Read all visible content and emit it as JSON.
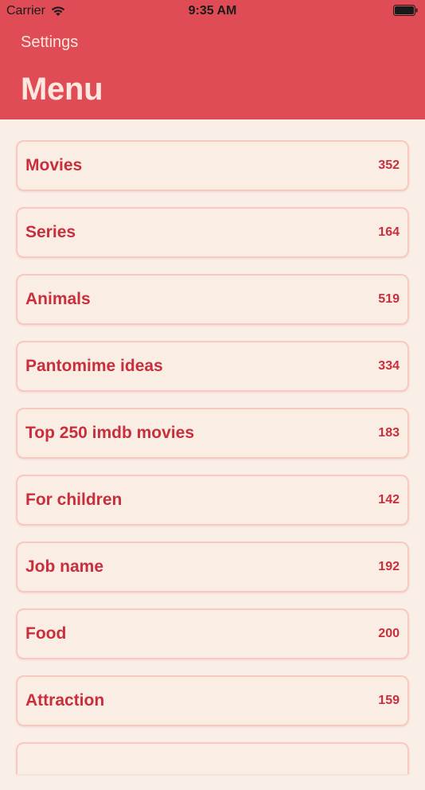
{
  "status_bar": {
    "carrier": "Carrier",
    "time": "9:35 AM"
  },
  "nav": {
    "back_label": "Settings",
    "title": "Menu"
  },
  "colors": {
    "header_bg": "#e04c55",
    "accent_text": "#c92e3d",
    "page_bg": "#f9efe7"
  },
  "menu": {
    "items": [
      {
        "label": "Movies",
        "count": "352"
      },
      {
        "label": "Series",
        "count": "164"
      },
      {
        "label": "Animals",
        "count": "519"
      },
      {
        "label": "Pantomime ideas",
        "count": "334"
      },
      {
        "label": "Top 250 imdb movies",
        "count": "183"
      },
      {
        "label": "For children",
        "count": "142"
      },
      {
        "label": "Job name",
        "count": "192"
      },
      {
        "label": "Food",
        "count": "200"
      },
      {
        "label": "Attraction",
        "count": "159"
      }
    ]
  }
}
